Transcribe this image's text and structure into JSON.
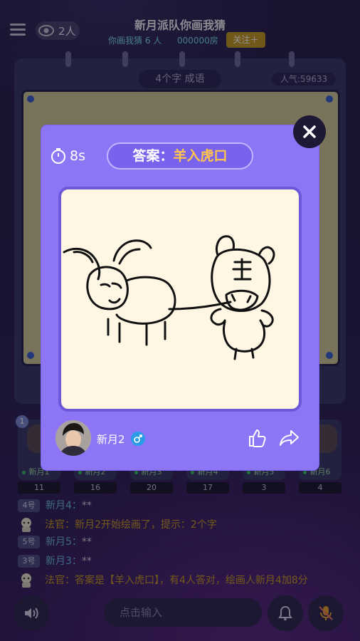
{
  "header": {
    "viewer_count": "2人",
    "room_title": "新月派队你画我猜",
    "room_subtitle": "你画我猜 6 人",
    "room_id": "000000房",
    "follow_label": "关注＋"
  },
  "board": {
    "hint": "4个字  成语",
    "popularity": "人气:59633"
  },
  "players": [
    {
      "name": "新月1",
      "score": "11",
      "badge": "1"
    },
    {
      "name": "新月2",
      "score": "16"
    },
    {
      "name": "新月3",
      "score": "20"
    },
    {
      "name": "新月4",
      "score": "17"
    },
    {
      "name": "新月5",
      "score": "3"
    },
    {
      "name": "新月6",
      "score": "4"
    }
  ],
  "chat": [
    {
      "seat": "4号",
      "name": "新月4：",
      "text": "**"
    },
    {
      "name": "法官：",
      "text": "新月2开始绘画了，提示：2个字"
    },
    {
      "seat": "5号",
      "name": "新月5：",
      "text": "**"
    },
    {
      "seat": "3号",
      "name": "新月3：",
      "text": "**"
    },
    {
      "name": "法官：",
      "text": "答案是【羊入虎口】，有4人答对，绘画人新月4加8分"
    }
  ],
  "bottom": {
    "input_placeholder": "点击输入"
  },
  "modal": {
    "timer": "8s",
    "answer_label": "答案：",
    "answer": "羊入虎口",
    "drawer_name": "新月2",
    "gender": "male"
  },
  "icons": {
    "menu": "menu-icon",
    "viewers": "eye-icon",
    "close": "close-icon",
    "timer": "stopwatch-icon",
    "like": "thumbs-up-icon",
    "share": "share-icon",
    "speaker": "speaker-icon",
    "bell": "bell-icon",
    "mic": "mic-off-icon",
    "judge": "judge-avatar-icon"
  },
  "colors": {
    "modal_bg": "#8c76f6",
    "answer_highlight": "#ffc54d",
    "judge_text": "#c99b2c",
    "follow_button": "#c19a2c"
  }
}
